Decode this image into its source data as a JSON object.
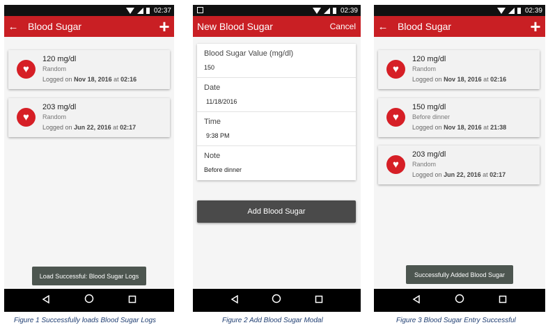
{
  "screens": [
    {
      "status": {
        "time": "02:37"
      },
      "app_bar": {
        "back_icon": "arrow-left",
        "title": "Blood Sugar",
        "action_icon": "plus"
      },
      "logs": [
        {
          "value": "120 mg/dl",
          "tag": "Random",
          "logged_prefix": "Logged on",
          "date": "Nov 18, 2016",
          "at": "at",
          "time": "02:16"
        },
        {
          "value": "203 mg/dl",
          "tag": "Random",
          "logged_prefix": "Logged on",
          "date": "Jun 22, 2016",
          "at": "at",
          "time": "02:17"
        }
      ],
      "toast": "Load Successful: Blood Sugar Logs",
      "caption": "Figure 1 Successfully loads Blood Sugar Logs"
    },
    {
      "status": {
        "time": "02:39"
      },
      "app_bar": {
        "title": "New Blood Sugar",
        "cancel_label": "Cancel"
      },
      "fields": [
        {
          "label": "Blood Sugar Value (mg/dl)",
          "value": "150"
        },
        {
          "label": "Date",
          "value": "11/18/2016"
        },
        {
          "label": "Time",
          "value": "9:38 PM"
        },
        {
          "label": "Note",
          "value": "Before dinner"
        }
      ],
      "submit_label": "Add Blood Sugar",
      "caption": "Figure 2 Add Blood Sugar Modal"
    },
    {
      "status": {
        "time": "02:39"
      },
      "app_bar": {
        "back_icon": "arrow-left",
        "title": "Blood Sugar",
        "action_icon": "plus"
      },
      "logs": [
        {
          "value": "120 mg/dl",
          "tag": "Random",
          "logged_prefix": "Logged on",
          "date": "Nov 18, 2016",
          "at": "at",
          "time": "02:16"
        },
        {
          "value": "150 mg/dl",
          "tag": "Before dinner",
          "logged_prefix": "Logged on",
          "date": "Nov 18, 2016",
          "at": "at",
          "time": "21:38"
        },
        {
          "value": "203 mg/dl",
          "tag": "Random",
          "logged_prefix": "Logged on",
          "date": "Jun 22, 2016",
          "at": "at",
          "time": "02:17"
        }
      ],
      "toast": "Successfully Added Blood Sugar",
      "caption": "Figure 3 Blood Sugar Entry Successful"
    }
  ],
  "colors": {
    "app_bar": "#c91f24",
    "badge": "#d61f26",
    "button": "#4a4a4a",
    "toast": "#4d5650",
    "caption": "#1f3e72"
  }
}
